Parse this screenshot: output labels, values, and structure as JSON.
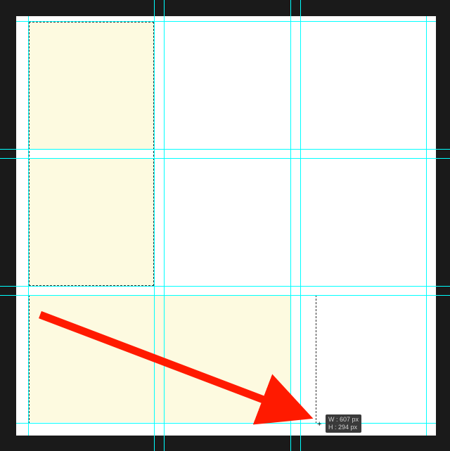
{
  "canvas": {
    "pasteboard_color": "#1a1a1a",
    "page_color": "#ffffff",
    "highlight_color": "#fdfae0",
    "guide_color": "#00ffff"
  },
  "tooltip": {
    "width_label": "W : 607 px",
    "height_label": "H : 294 px"
  }
}
